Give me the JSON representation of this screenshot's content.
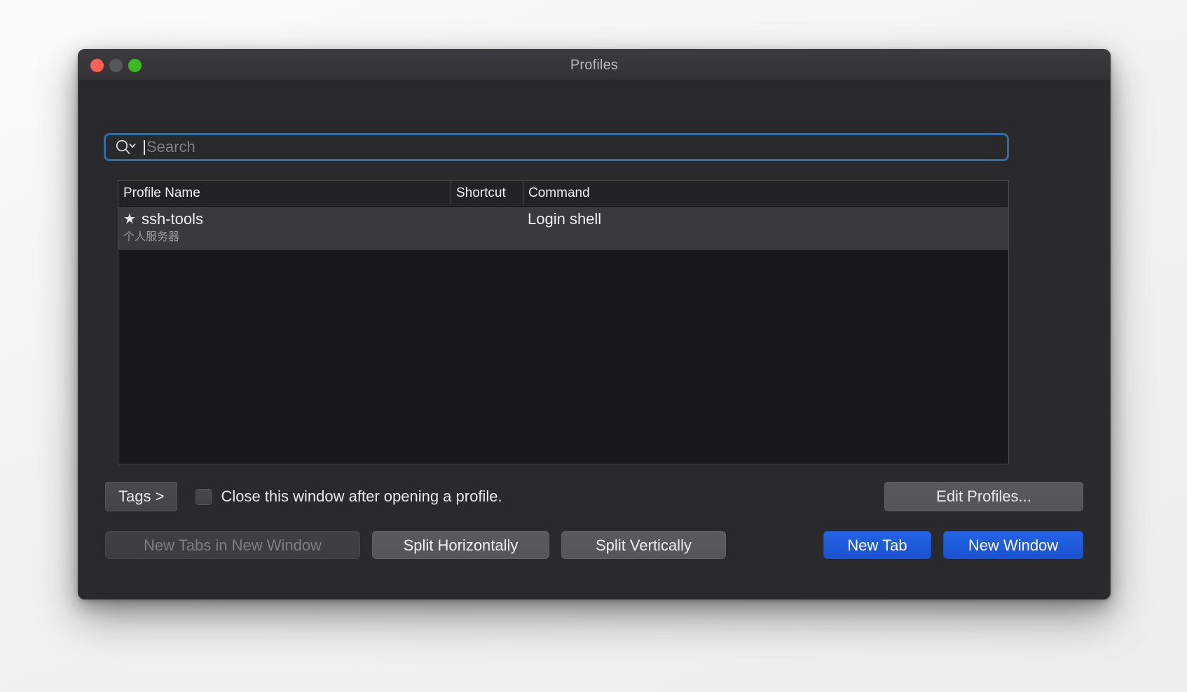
{
  "window": {
    "title": "Profiles",
    "traffic_lights": [
      {
        "name": "close",
        "color": "#ff5f57"
      },
      {
        "name": "minimize",
        "color": "#575759"
      },
      {
        "name": "maximize",
        "color": "#3bb91f"
      }
    ]
  },
  "search": {
    "placeholder": "Search",
    "value": "",
    "icon": "search-magnifier-chevron-icon"
  },
  "table": {
    "columns": [
      "Profile Name",
      "Shortcut",
      "Command"
    ],
    "rows": [
      {
        "favorite": true,
        "favorite_icon": "star-icon",
        "profile_name": "ssh-tools",
        "profile_subtitle": "个人服务器",
        "shortcut": "",
        "command": "Login shell",
        "selected": true
      }
    ]
  },
  "options": {
    "tags_button": "Tags >",
    "close_window_checkbox": {
      "label": "Close this window after opening a profile.",
      "checked": false
    },
    "edit_profiles_button": "Edit Profiles..."
  },
  "actions": [
    {
      "label": "New Tabs in New Window",
      "style": "disabled"
    },
    {
      "label": "Split Horizontally",
      "style": "grey"
    },
    {
      "label": "Split Vertically",
      "style": "grey"
    },
    {
      "label": "New Tab",
      "style": "blue"
    },
    {
      "label": "New Window",
      "style": "blue"
    }
  ],
  "colors": {
    "accent_blue": "#2264e8",
    "focus_ring": "#2f6ba4",
    "window_bg": "#2a2a2c",
    "list_bg": "#19191b",
    "row_selected": "#3a3a3c"
  }
}
